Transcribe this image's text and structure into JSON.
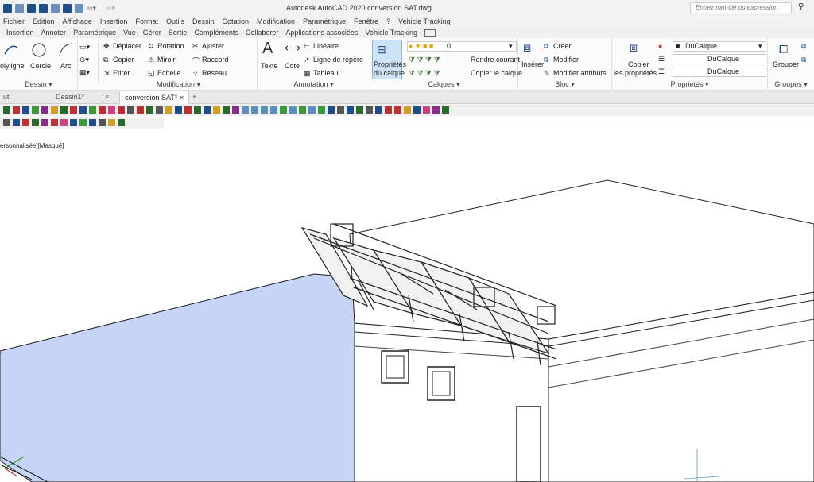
{
  "window": {
    "title": "Autodesk AutoCAD 2020   conversion SAT.dwg"
  },
  "search": {
    "placeholder": "Entrez mot-clé ou expression"
  },
  "menu": [
    "Fichier",
    "Edition",
    "Affichage",
    "Insertion",
    "Format",
    "Outils",
    "Dessin",
    "Cotation",
    "Modification",
    "Paramétrique",
    "Fenêtre",
    "?",
    "Vehicle Tracking"
  ],
  "ribbon_tabs": [
    "Insertion",
    "Annoter",
    "Paramétrique",
    "Vue",
    "Gérer",
    "Sortie",
    "Compléments",
    "Collaborer",
    "Applications associées",
    "Vehicle Tracking"
  ],
  "ribbon": {
    "dessin": {
      "title": "Dessin ▾",
      "polyligne": "olyligne",
      "cercle": "Cercle",
      "arc": "Arc"
    },
    "modification": {
      "title": "Modification ▾",
      "deplacer": "Déplacer",
      "rotation": "Rotation",
      "ajuster": "Ajuster",
      "copier": "Copier",
      "miroir": "Miroir",
      "raccord": "Raccord",
      "etirer": "Etirer",
      "echelle": "Echelle",
      "reseau": "Réseau"
    },
    "annotation": {
      "title": "Annotation ▾",
      "texte": "Texte",
      "cote": "Cote",
      "lineaire": "Linéaire",
      "ligne_repere": "Ligne de repère",
      "tableau": "Tableau"
    },
    "calques": {
      "title": "Calques ▾",
      "proprietes": "Propriétés",
      "du_calque": "du calque",
      "layer_value": "0",
      "rendre_courant": "Rendre courant",
      "copier_calque": "Copier le calque"
    },
    "bloc": {
      "title": "Bloc ▾",
      "inserer": "Insérer",
      "creer": "Créer",
      "modifier": "Modifier",
      "modifier_attributs": "Modifier attributs"
    },
    "proprietes": {
      "title": "Propriétés ▾",
      "copier": "Copier",
      "les_proprietes": "les propriétés",
      "color": "DuCalque",
      "linetype": "DuCalque",
      "lineweight": "DuCalque"
    },
    "groupes": {
      "title": "Groupes ▾",
      "grouper": "Grouper"
    }
  },
  "doc_tabs": {
    "t1": "ut",
    "t2": "Dessin1*",
    "t3": "conversion SAT*",
    "close": "×",
    "add": "+"
  },
  "viewport_label": "ersonnalisée][Masqué]",
  "colors": {
    "ground": "#c6d5f6",
    "accent": "#1f4e8c"
  }
}
